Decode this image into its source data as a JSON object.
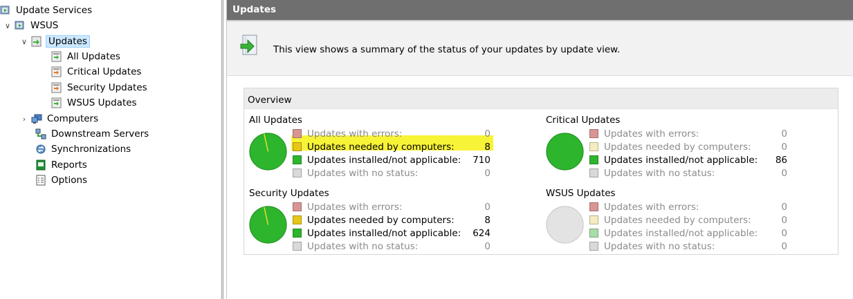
{
  "tree": {
    "root": "Update Services",
    "server": "WSUS",
    "updates": "Updates",
    "all_updates": "All Updates",
    "critical_updates": "Critical Updates",
    "security_updates": "Security Updates",
    "wsus_updates": "WSUS Updates",
    "computers": "Computers",
    "downstream": "Downstream Servers",
    "sync": "Synchronizations",
    "reports": "Reports",
    "options": "Options"
  },
  "pane": {
    "title": "Updates",
    "info": "This view shows a summary of the status of your updates by update view.",
    "overview": "Overview"
  },
  "legend": {
    "errors": "Updates with errors:",
    "needed": "Updates needed by computers:",
    "installed": "Updates installed/not applicable:",
    "nostatus": "Updates with no status:"
  },
  "groups": {
    "all": {
      "title": "All Updates",
      "errors": "0",
      "needed": "8",
      "installed": "710",
      "nostatus": "0"
    },
    "critical": {
      "title": "Critical Updates",
      "errors": "0",
      "needed": "0",
      "installed": "86",
      "nostatus": "0"
    },
    "security": {
      "title": "Security Updates",
      "errors": "0",
      "needed": "8",
      "installed": "624",
      "nostatus": "0"
    },
    "wsus": {
      "title": "WSUS Updates",
      "errors": "0",
      "needed": "0",
      "installed": "0",
      "nostatus": "0"
    }
  },
  "colors": {
    "errors": "#d99594",
    "needed": "#e6c619",
    "installed": "#2db52d",
    "nostatus": "#d9d9d9",
    "highlight": "#f6f221",
    "titlebar": "#6f6f6f"
  }
}
